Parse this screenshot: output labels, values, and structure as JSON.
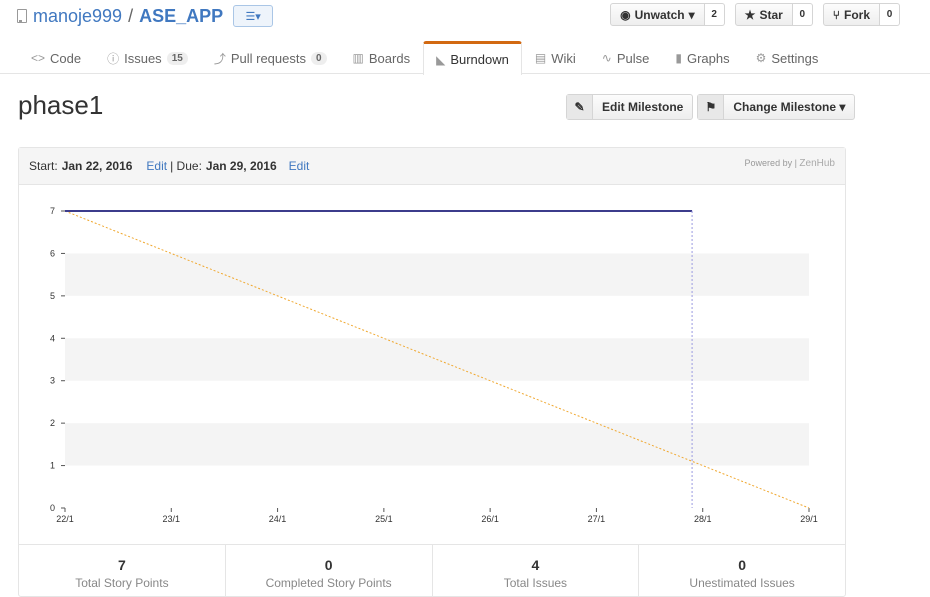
{
  "repo": {
    "owner": "manoje999",
    "separator": "/",
    "name": "ASE_APP"
  },
  "actions": {
    "watch": {
      "label": "Unwatch",
      "count": "2"
    },
    "star": {
      "label": "Star",
      "count": "0"
    },
    "fork": {
      "label": "Fork",
      "count": "0"
    }
  },
  "tabs": [
    {
      "label": "Code",
      "icon": "code-icon"
    },
    {
      "label": "Issues",
      "icon": "issue-icon",
      "badge": "15"
    },
    {
      "label": "Pull requests",
      "icon": "pull-request-icon",
      "badge": "0"
    },
    {
      "label": "Boards",
      "icon": "boards-icon"
    },
    {
      "label": "Burndown",
      "icon": "burndown-icon",
      "selected": true
    },
    {
      "label": "Wiki",
      "icon": "wiki-icon"
    },
    {
      "label": "Pulse",
      "icon": "pulse-icon"
    },
    {
      "label": "Graphs",
      "icon": "graph-icon"
    },
    {
      "label": "Settings",
      "icon": "gear-icon"
    }
  ],
  "milestone": {
    "title": "phase1",
    "edit_label": "Edit Milestone",
    "change_label": "Change Milestone"
  },
  "panel": {
    "start_label": "Start:",
    "start_date": "Jan 22, 2016",
    "edit_start": "Edit",
    "due_label": "| Due:",
    "due_date": "Jan 29, 2016",
    "edit_due": "Edit",
    "powered_by": "Powered by",
    "powered_brand": "ZenHub"
  },
  "chart_data": {
    "type": "line",
    "x": [
      "22/1",
      "23/1",
      "24/1",
      "25/1",
      "26/1",
      "27/1",
      "28/1",
      "29/1"
    ],
    "ylim": [
      0,
      7
    ],
    "yticks": [
      0,
      1,
      2,
      3,
      4,
      5,
      6,
      7
    ],
    "series": [
      {
        "values": [
          7,
          7,
          7,
          7,
          7,
          7,
          7,
          null
        ],
        "end_x": 5.9,
        "color": "#3c3c8c"
      },
      {
        "values": [
          7,
          6,
          5,
          4,
          3,
          2,
          1,
          0
        ],
        "color": "#f0a830",
        "dashed": true
      }
    ],
    "today_marker_x": 5.9,
    "today_color": "#9a9ae0",
    "band_color": "#f4f4f4"
  },
  "stats": [
    {
      "value": "7",
      "label": "Total Story Points"
    },
    {
      "value": "0",
      "label": "Completed Story Points"
    },
    {
      "value": "4",
      "label": "Total Issues"
    },
    {
      "value": "0",
      "label": "Unestimated Issues"
    }
  ]
}
